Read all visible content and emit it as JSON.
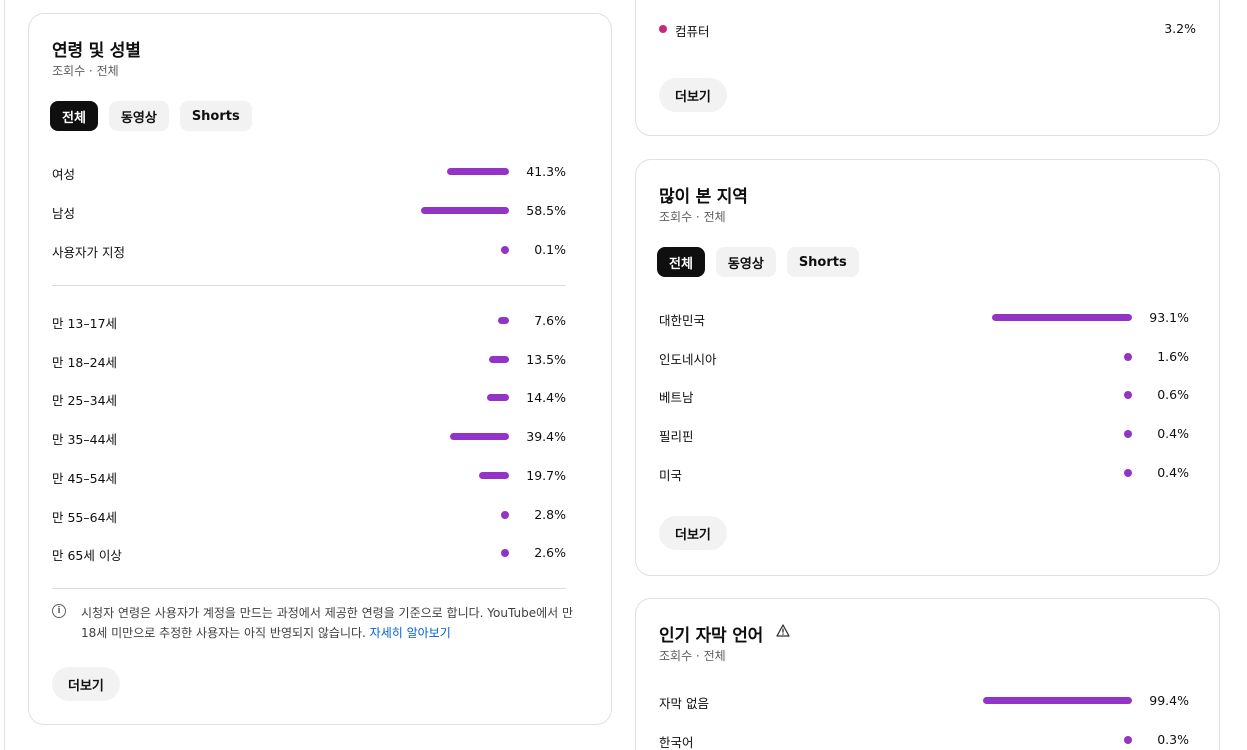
{
  "bar_color": "#9334c7",
  "age_gender": {
    "title": "연령 및 성별",
    "subtitle": "조회수 · 전체",
    "chips": [
      "전체",
      "동영상",
      "Shorts"
    ],
    "gender_rows": [
      {
        "label": "여성",
        "value": "41.3%",
        "level": 41.3
      },
      {
        "label": "남성",
        "value": "58.5%",
        "level": 58.5
      },
      {
        "label": "사용자가 지정",
        "value": "0.1%",
        "level": 0.1
      }
    ],
    "age_rows": [
      {
        "label": "만 13–17세",
        "value": "7.6%",
        "level": 7.6
      },
      {
        "label": "만 18–24세",
        "value": "13.5%",
        "level": 13.5
      },
      {
        "label": "만 25–34세",
        "value": "14.4%",
        "level": 14.4
      },
      {
        "label": "만 35–44세",
        "value": "39.4%",
        "level": 39.4
      },
      {
        "label": "만 45–54세",
        "value": "19.7%",
        "level": 19.7
      },
      {
        "label": "만 55–64세",
        "value": "2.8%",
        "level": 2.8
      },
      {
        "label": "만 65세 이상",
        "value": "2.6%",
        "level": 2.6
      }
    ],
    "note_text": "시청자 연령은 사용자가 계정을 만드는 과정에서 제공한 연령을 기준으로 합니다. YouTube에서 만 18세 미만으로 추정한 사용자는 아직 반영되지 않습니다. ",
    "note_link": "자세히 알아보기",
    "more_label": "더보기"
  },
  "top_card": {
    "row": {
      "label": "컴퓨터",
      "value": "3.2%"
    },
    "dot_color": "#c8277a",
    "more_label": "더보기"
  },
  "region": {
    "title": "많이 본 지역",
    "subtitle": "조회수 · 전체",
    "chips": [
      "전체",
      "동영상",
      "Shorts"
    ],
    "rows": [
      {
        "label": "대한민국",
        "value": "93.1%",
        "level": 93.1
      },
      {
        "label": "인도네시아",
        "value": "1.6%",
        "level": 1.6
      },
      {
        "label": "베트남",
        "value": "0.6%",
        "level": 0.6
      },
      {
        "label": "필리핀",
        "value": "0.4%",
        "level": 0.4
      },
      {
        "label": "미국",
        "value": "0.4%",
        "level": 0.4
      }
    ],
    "more_label": "더보기"
  },
  "language": {
    "title": "인기 자막 언어",
    "warning_icon": "warning-icon",
    "subtitle": "조회수 · 전체",
    "rows": [
      {
        "label": "자막 없음",
        "value": "99.4%",
        "level": 99.4
      },
      {
        "label": "한국어",
        "value": "0.3%",
        "level": 0.3
      }
    ]
  }
}
